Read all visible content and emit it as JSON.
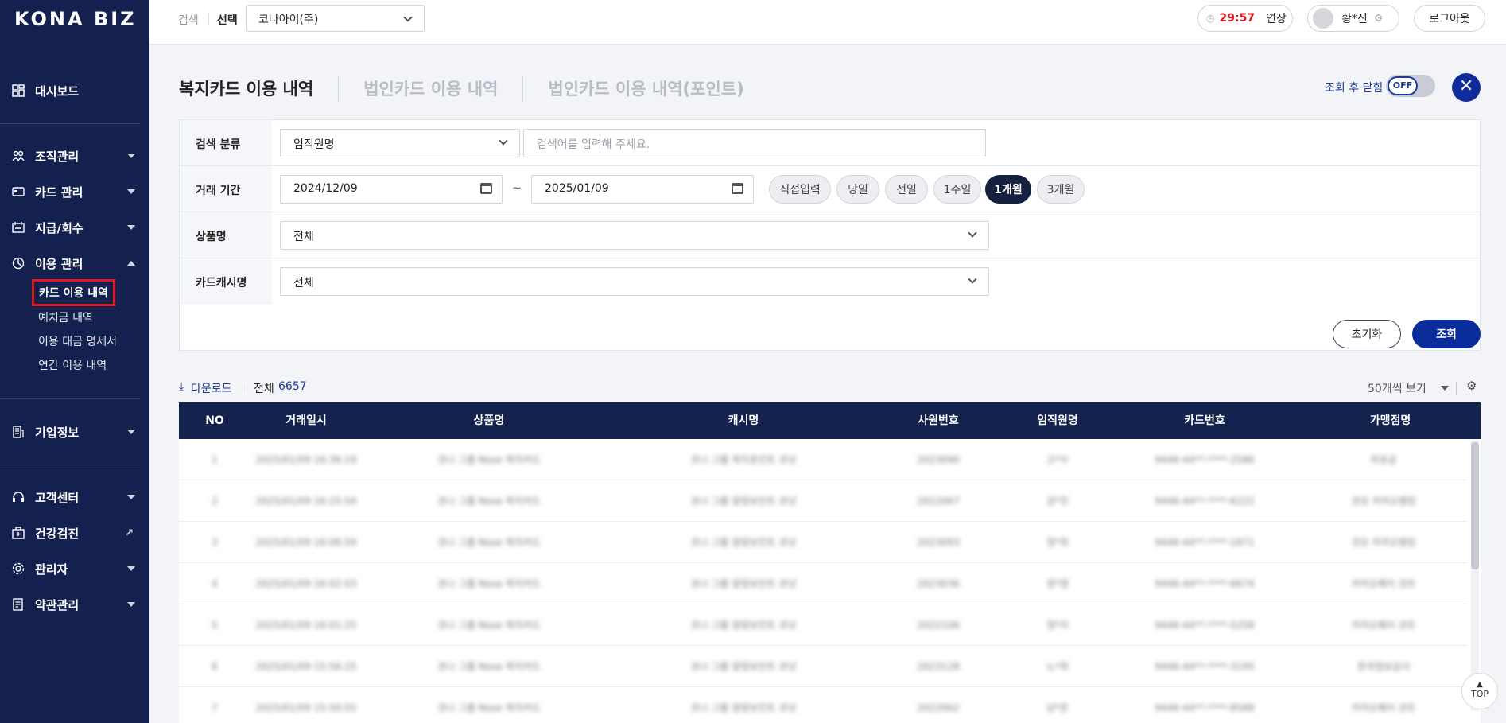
{
  "sidebar": {
    "logo": "KONA BIZ",
    "items": [
      {
        "label": "대시보드",
        "icon": "dashboard-icon"
      },
      {
        "label": "조직관리",
        "icon": "organization-icon"
      },
      {
        "label": "카드 관리",
        "icon": "card-icon"
      },
      {
        "label": "지급/회수",
        "icon": "payment-icon"
      },
      {
        "label": "이용 관리",
        "icon": "usage-icon"
      },
      {
        "label": "기업정보",
        "icon": "building-icon"
      },
      {
        "label": "고객센터",
        "icon": "headset-icon"
      },
      {
        "label": "건강검진",
        "icon": "health-icon"
      },
      {
        "label": "관리자",
        "icon": "admin-icon"
      },
      {
        "label": "약관관리",
        "icon": "terms-icon"
      }
    ],
    "sub_items": [
      "카드 이용 내역",
      "예치금 내역",
      "이용 대금 명세서",
      "연간 이용 내역"
    ]
  },
  "header": {
    "search_label": "검색",
    "select_label": "선택",
    "company": "코나아이(주)",
    "timer": "29:57",
    "extend": "연장",
    "user": "황*진",
    "logout": "로그아웃"
  },
  "tabs": [
    "복지카드 이용 내역",
    "법인카드 이용 내역",
    "법인카드 이용 내역(포인트)"
  ],
  "toggle": {
    "label": "조회 후 닫힘",
    "state": "OFF"
  },
  "form": {
    "search_category_label": "검색 분류",
    "search_category_value": "임직원명",
    "search_placeholder": "검색어를 입력해 주세요.",
    "period_label": "거래 기간",
    "date_from": "2024/12/09",
    "date_to": "2025/01/09",
    "tilde": "~",
    "period_buttons": [
      "직접입력",
      "당일",
      "전일",
      "1주일",
      "1개월",
      "3개월"
    ],
    "active_period": "1개월",
    "product_label": "상품명",
    "product_value": "전체",
    "cashier_label": "카드캐시명",
    "cashier_value": "전체"
  },
  "actions": {
    "reset": "초기화",
    "search": "조회"
  },
  "list": {
    "download": "다운로드",
    "total_label": "전체",
    "total_count": "6657",
    "page_size": "50개씩 보기"
  },
  "table": {
    "columns": [
      "NO",
      "거래일시",
      "상품명",
      "캐시명",
      "사원번호",
      "임직원명",
      "카드번호",
      "가맹점명"
    ],
    "rows": [
      [
        "1",
        "2025/01/09 16:36:19",
        "코나 그룹 Nose 복지카드",
        "코나 그룹 복지포인트 코넛",
        "2023090",
        "고*수",
        "9446-44**-****-2586",
        "하포공"
      ],
      [
        "2",
        "2025/01/09 16:25:54",
        "코나 그룹 Nose 복지카드",
        "코나 그룹 알맞보인트 코넛",
        "2022067",
        "강*진",
        "9446-44**-****-6222",
        "코모 카카오뱅킹"
      ],
      [
        "3",
        "2025/01/09 16:06:59",
        "코나 그룹 Nose 복지카드",
        "코나 그룹 알맞보인트 코넛",
        "2023093",
        "정*희",
        "9446-44**-****-1871",
        "코모 카카오뱅킹"
      ],
      [
        "4",
        "2025/01/09 16:02:03",
        "코나 그룹 Nose 복지카드",
        "코나 그룹 알맞보인트 코넛",
        "2023036",
        "정*영",
        "9446-44**-****-6674",
        "카카오페이 코트"
      ],
      [
        "5",
        "2025/01/09 16:01:25",
        "코나 그룹 Nose 복지카드",
        "코나 그룹 알맞보인트 코넛",
        "2022106",
        "정*지",
        "9446-44**-****-5258",
        "카카오페이 코트"
      ],
      [
        "6",
        "2025/01/09 15:56:25",
        "코나 그룹 Nose 복지카드",
        "코나 그룹 알맞보인트 코넛",
        "2023128",
        "노*희",
        "9446-44**-****-3195",
        "한국정보공사"
      ],
      [
        "7",
        "2025/01/09 15:50:55",
        "코나 그룹 Nose 복지카드",
        "코나 그룹 알맞보인트 코넛",
        "2022062",
        "남*준",
        "9446-44**-****-8588",
        "카카오페이 코트"
      ]
    ]
  },
  "top_button": "TOP",
  "colors": {
    "sidebar": "#14214f",
    "primary": "#0b2d9c",
    "timer": "#e4141c",
    "table_head": "#13234e"
  }
}
